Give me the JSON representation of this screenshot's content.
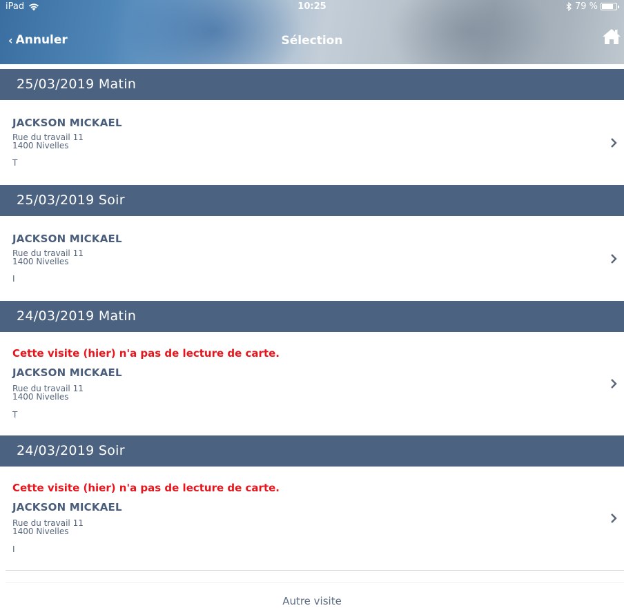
{
  "status_bar": {
    "device": "iPad",
    "time": "10:25",
    "battery": "79 %",
    "battery_level": 0.79
  },
  "nav": {
    "back_label": "Annuler",
    "title": "Sélection",
    "home_icon": "home-icon"
  },
  "sections": [
    {
      "header": "25/03/2019 Matin",
      "item": {
        "warning": "",
        "name": "JACKSON MICKAEL",
        "address_line1": "Rue du travail 11",
        "address_line2": "1400 Nivelles",
        "code": "T"
      }
    },
    {
      "header": "25/03/2019 Soir",
      "item": {
        "warning": "",
        "name": "JACKSON MICKAEL",
        "address_line1": "Rue du travail 11",
        "address_line2": "1400 Nivelles",
        "code": "I"
      }
    },
    {
      "header": "24/03/2019 Matin",
      "item": {
        "warning": "Cette visite (hier) n'a pas de lecture de carte.",
        "name": "JACKSON MICKAEL",
        "address_line1": "Rue du travail 11",
        "address_line2": "1400 Nivelles",
        "code": "T"
      }
    },
    {
      "header": "24/03/2019 Soir",
      "item": {
        "warning": "Cette visite (hier) n'a pas de lecture de carte.",
        "name": "JACKSON MICKAEL",
        "address_line1": "Rue du travail 11",
        "address_line2": "1400 Nivelles",
        "code": "I"
      }
    }
  ],
  "footer": {
    "other_visit_label": "Autre visite"
  },
  "colors": {
    "section_header": "#4c6281",
    "warning": "#e8141b",
    "name": "#4a5d7a"
  }
}
